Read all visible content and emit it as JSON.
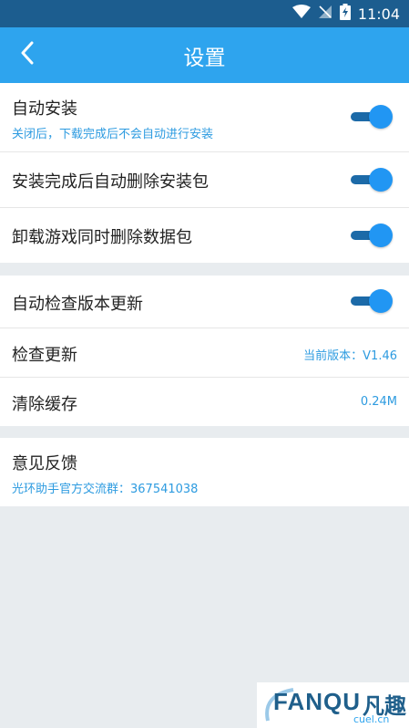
{
  "status_bar": {
    "time": "11:04"
  },
  "header": {
    "title": "设置"
  },
  "settings": {
    "auto_install": {
      "title": "自动安装",
      "subtitle": "关闭后，下载完成后不会自动进行安装",
      "enabled": true
    },
    "delete_after_install": {
      "title": "安装完成后自动删除安装包",
      "enabled": true
    },
    "delete_on_uninstall": {
      "title": "卸载游戏同时删除数据包",
      "enabled": true
    },
    "auto_check_update": {
      "title": "自动检查版本更新",
      "enabled": true
    },
    "check_update": {
      "title": "检查更新",
      "value": "当前版本：V1.46"
    },
    "clear_cache": {
      "title": "清除缓存",
      "value": "0.24M"
    },
    "feedback": {
      "title": "意见反馈",
      "subtitle": "光环助手官方交流群：367541038"
    }
  },
  "watermark": {
    "text": "FANQU",
    "text_cn": "凡趣",
    "domain": "cuel.cn"
  },
  "icons": {
    "back": "chevron-left-icon",
    "wifi": "wifi-icon",
    "signal": "no-signal-icon",
    "battery": "battery-charging-icon"
  },
  "colors": {
    "status_bar": "#1c5d8f",
    "app_bar": "#2ea4ee",
    "accent_text": "#2d9be0",
    "toggle_thumb": "#2196f3",
    "toggle_track": "#1c6aa8",
    "background": "#e8ecef"
  }
}
